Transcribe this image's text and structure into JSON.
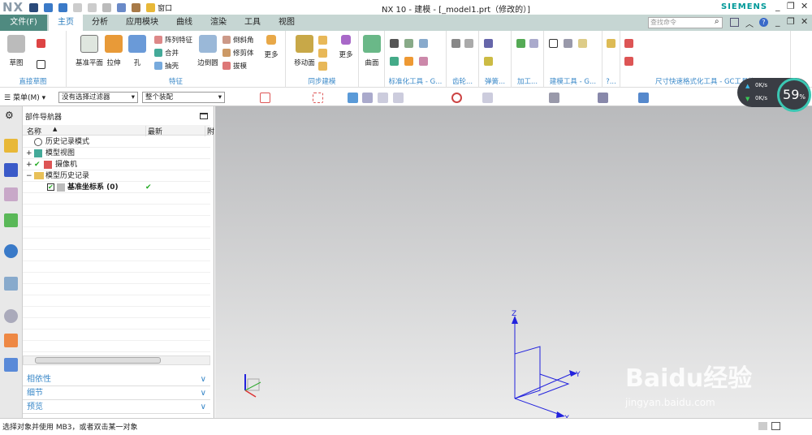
{
  "app": {
    "logo": "NX",
    "title": "NX 10 - 建模 - [_model1.prt（修改的）]",
    "brand": "SIEMENS",
    "window_menu": "窗口"
  },
  "tabs": [
    {
      "label": "文件(F)"
    },
    {
      "label": "主页"
    },
    {
      "label": "分析"
    },
    {
      "label": "应用模块"
    },
    {
      "label": "曲线"
    },
    {
      "label": "渲染"
    },
    {
      "label": "工具"
    },
    {
      "label": "视图"
    }
  ],
  "search": {
    "placeholder": "查找命令"
  },
  "ribbon": {
    "sketch": {
      "sketch": "草图",
      "label": "直接草图"
    },
    "feature": {
      "datum": "基准平面",
      "extrude": "拉伸",
      "hole": "孔",
      "pattern": "阵列特征",
      "unite": "合并",
      "shell": "抽壳",
      "edge_blend": "边倒圆",
      "chamfer": "倒斜角",
      "trim": "修剪体",
      "draft": "拔模",
      "more": "更多",
      "label": "特征"
    },
    "sync": {
      "move_face": "移动面",
      "more": "更多",
      "label": "同步建模"
    },
    "surface": {
      "surface": "曲面"
    },
    "groups": [
      "标准化工具 - G...",
      "齿轮...",
      "弹簧...",
      "加工...",
      "建模工具 - G...",
      "?...",
      "尺寸快速格式化工具 - GC工具箱"
    ]
  },
  "toolbar": {
    "menu": "菜单(M)",
    "filter": "没有选择过滤器",
    "assembly": "整个装配"
  },
  "navigator": {
    "title": "部件导航器",
    "columns": [
      "名称",
      "最新",
      "附"
    ],
    "rows": [
      {
        "label": "历史记录模式",
        "latest": ""
      },
      {
        "label": "模型视图",
        "latest": ""
      },
      {
        "label": "摄像机",
        "latest": ""
      },
      {
        "label": "模型历史记录",
        "latest": ""
      },
      {
        "label": "基准坐标系 (0)",
        "latest": "✔"
      }
    ],
    "panels": [
      "相依性",
      "细节",
      "预览"
    ]
  },
  "status": {
    "text": "选择对象并使用 MB3，或者双击某一对象"
  },
  "monitor": {
    "up": "0K/s",
    "down": "0K/s",
    "percent": "59",
    "unit": "%"
  },
  "axes": {
    "x": "X",
    "y": "Y",
    "z": "Z"
  },
  "watermark": {
    "brand": "Baidu经验",
    "url": "jingyan.baidu.com"
  }
}
